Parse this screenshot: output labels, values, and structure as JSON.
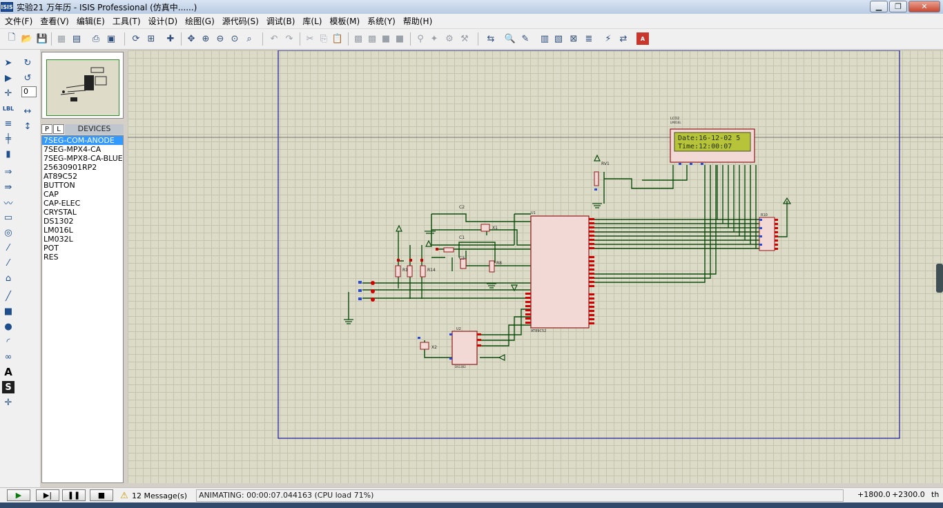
{
  "window": {
    "title": "实验21 万年历 - ISIS Professional (仿真中......)",
    "app_icon": "ISIS"
  },
  "menu": [
    "文件(F)",
    "查看(V)",
    "编辑(E)",
    "工具(T)",
    "设计(D)",
    "绘图(G)",
    "源代码(S)",
    "调试(B)",
    "库(L)",
    "模板(M)",
    "系统(Y)",
    "帮助(H)"
  ],
  "rotation_value": "0",
  "devices_panel": {
    "p_label": "P",
    "l_label": "L",
    "title": "DEVICES",
    "items": [
      "7SEG-COM-ANODE",
      "7SEG-MPX4-CA",
      "7SEG-MPX8-CA-BLUE",
      "25630901RP2",
      "AT89C52",
      "BUTTON",
      "CAP",
      "CAP-ELEC",
      "CRYSTAL",
      "DS1302",
      "LM016L",
      "LM032L",
      "POT",
      "RES"
    ],
    "selected_index": 0
  },
  "lcd": {
    "ref": "LCD2",
    "part": "LM016L",
    "line1": "Date:16-12-02  5",
    "line2": "Time:12:00:07"
  },
  "schematic_labels": {
    "mcu_ref": "U1",
    "mcu_part": "AT89C52",
    "rtc_ref": "U2",
    "rtc_part": "DS1302",
    "pot_ref": "RV1",
    "rpack_ref": "R10",
    "c1": "C1",
    "c2": "C2",
    "c3": "C3",
    "x1": "X1",
    "x2": "X2",
    "r1": "R1",
    "r8": "R8",
    "r14": "R14"
  },
  "status": {
    "messages": "12 Message(s)",
    "animation": "ANIMATING: 00:00:07.044163 (CPU load 71%)",
    "coord_x": "+1800.0",
    "coord_y": "+2300.0",
    "units": "th"
  },
  "colors": {
    "wire": "#0b4a0b",
    "pin": "#d40000",
    "border": "#1a1a9c",
    "chip_fill": "#f3d9d6",
    "chip_stroke": "#8c1a1a",
    "lcd_screen": "#b7c43a"
  }
}
